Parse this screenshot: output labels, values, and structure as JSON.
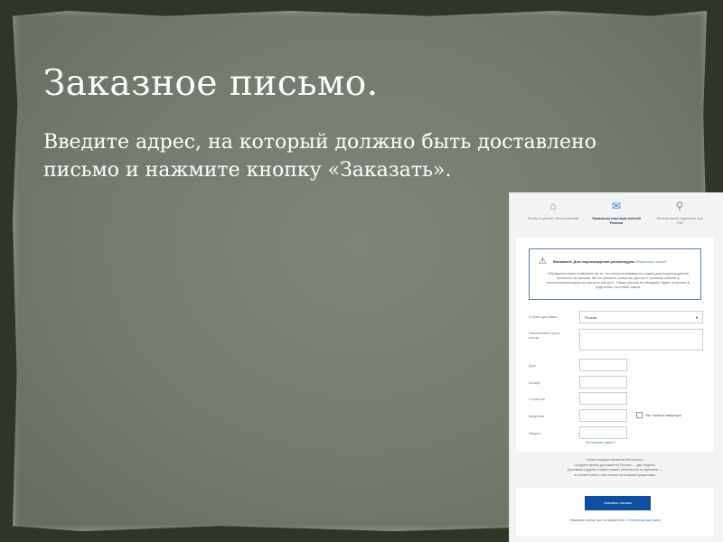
{
  "slide": {
    "title": "Заказное письмо.",
    "body": "Введите адрес, на который должно быть доставлено письмо и нажмите кнопку «Заказать»."
  },
  "screenshot": {
    "tabs": [
      {
        "icon": "service-center-icon",
        "label": "Лично в центре обслуживания"
      },
      {
        "icon": "envelope-icon",
        "label": "Заказным письмом почтой России"
      },
      {
        "icon": "usb-key-icon",
        "label": "Электронной подписью или УЭК"
      }
    ],
    "warning": {
      "title": "Внимание! Для подтверждения рекомендуем",
      "link": "обратиться лично!",
      "text": "Обращаем ваше внимание на то, что воспользовавшись кодом для подтверждения личности из письма, вы не сможете получить доступ к личному кабинету налогоплательщика на портале nalog.ru. Такие письма необходимо будет получать в отделении почтовой связи."
    },
    "form": {
      "country_label": "Страна доставки",
      "country_value": "Россия",
      "city_label": "Населенный пункт, улица",
      "house_label": "Дом",
      "building_label": "Корпус",
      "structure_label": "Строение",
      "apartment_label": "Квартира",
      "no_apartment_label": "Нет номера квартиры",
      "index_label": "Индекс",
      "index_help": "Не помните индекс?"
    },
    "info": [
      "Услуга предоставляется бесплатно.",
      "Среднее время доставки по России — две недели.",
      "Доставка в другие страны может отличаться по времени —",
      "в соответствии с местными почтовыми правилами."
    ],
    "submit_label": "Заказать письмо",
    "agree_text": "Нажимая кнопку, вы соглашаетесь с",
    "agree_link": "Условиями доставки"
  }
}
